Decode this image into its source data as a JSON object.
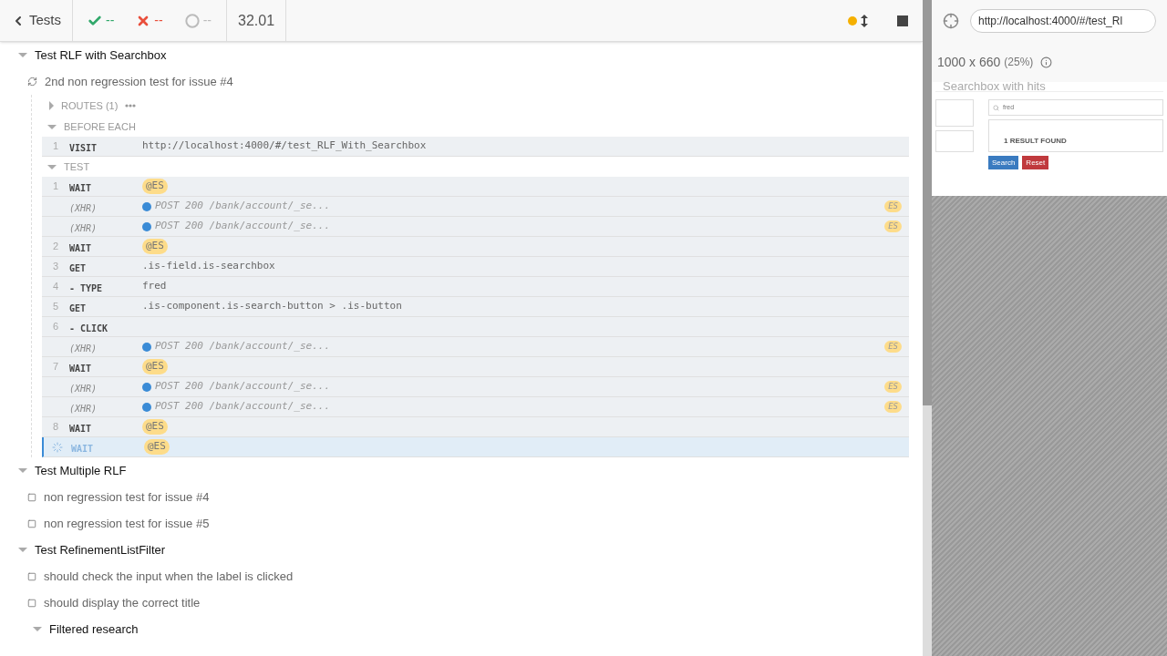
{
  "header": {
    "back": "Tests",
    "passed": "--",
    "failed": "--",
    "pending": "--",
    "duration": "32.01",
    "running": true
  },
  "suites": [
    {
      "title": "Test RLF with Searchbox",
      "expanded": true,
      "tests": [
        {
          "title": "2nd non regression test for issue #4",
          "running": true,
          "routes": {
            "label": "ROUTES (1)",
            "expanded": false
          },
          "hooks": [
            {
              "label": "BEFORE EACH",
              "expanded": true,
              "commands": [
                {
                  "kind": "command",
                  "number": "1",
                  "name": "VISIT",
                  "message": "http://localhost:4000/#/test_RLF_With_Searchbox",
                  "running": false
                }
              ]
            },
            {
              "label": "TEST",
              "expanded": true,
              "commands": [
                {
                  "kind": "command",
                  "number": "1",
                  "name": "WAIT",
                  "alias": "@ES",
                  "running": false
                },
                {
                  "kind": "xhr",
                  "name": "(XHR)",
                  "message": "POST 200 /bank/account/_se...",
                  "badge": "ES"
                },
                {
                  "kind": "xhr",
                  "name": "(XHR)",
                  "message": "POST 200 /bank/account/_se...",
                  "badge": "ES"
                },
                {
                  "kind": "command",
                  "number": "2",
                  "name": "WAIT",
                  "alias": "@ES",
                  "running": false
                },
                {
                  "kind": "command",
                  "number": "3",
                  "name": "GET",
                  "message": ".is-field.is-searchbox",
                  "running": false
                },
                {
                  "kind": "command",
                  "number": "4",
                  "name": "- TYPE",
                  "message": "fred",
                  "running": false
                },
                {
                  "kind": "command",
                  "number": "5",
                  "name": "GET",
                  "message": ".is-component.is-search-button > .is-button",
                  "running": false
                },
                {
                  "kind": "command",
                  "number": "6",
                  "name": "- CLICK",
                  "running": false
                },
                {
                  "kind": "xhr",
                  "name": "(XHR)",
                  "message": "POST 200 /bank/account/_se...",
                  "badge": "ES"
                },
                {
                  "kind": "command",
                  "number": "7",
                  "name": "WAIT",
                  "alias": "@ES",
                  "running": false
                },
                {
                  "kind": "xhr",
                  "name": "(XHR)",
                  "message": "POST 200 /bank/account/_se...",
                  "badge": "ES"
                },
                {
                  "kind": "xhr",
                  "name": "(XHR)",
                  "message": "POST 200 /bank/account/_se...",
                  "badge": "ES"
                },
                {
                  "kind": "command",
                  "number": "8",
                  "name": "WAIT",
                  "alias": "@ES",
                  "running": false
                },
                {
                  "kind": "command",
                  "name": "WAIT",
                  "alias": "@ES",
                  "running": true
                }
              ]
            }
          ]
        }
      ]
    },
    {
      "title": "Test Multiple RLF",
      "expanded": true,
      "tests": [
        {
          "title": "non regression test for issue #4",
          "running": false
        },
        {
          "title": "non regression test for issue #5",
          "running": false
        }
      ]
    },
    {
      "title": "Test RefinementListFilter",
      "expanded": true,
      "tests": [
        {
          "title": "should check the input when the label is clicked",
          "running": false
        },
        {
          "title": "should display the correct title",
          "running": false
        }
      ],
      "subsuites": [
        {
          "title": "Filtered research",
          "expanded": true
        }
      ]
    }
  ],
  "preview": {
    "url": "http://localhost:4000/#/test_Rl",
    "viewport": "1000 x 660",
    "scale": "(25%)",
    "app": {
      "title": "Searchbox with hits",
      "query": "fred",
      "result": "1 RESULT FOUND",
      "buttons": [
        "Search",
        "Reset"
      ]
    }
  }
}
